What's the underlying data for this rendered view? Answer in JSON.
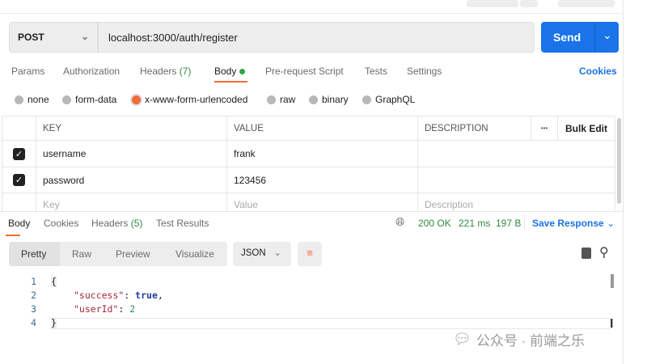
{
  "request": {
    "method": "POST",
    "url": "localhost:3000/auth/register",
    "send_label": "Send"
  },
  "tabs": [
    {
      "label": "Params"
    },
    {
      "label": "Authorization"
    },
    {
      "label": "Headers",
      "count": "(7)"
    },
    {
      "label": "Body"
    },
    {
      "label": "Pre-request Script"
    },
    {
      "label": "Tests"
    },
    {
      "label": "Settings"
    }
  ],
  "cookies_label": "Cookies",
  "body_types": [
    "none",
    "form-data",
    "x-www-form-urlencoded",
    "raw",
    "binary",
    "GraphQL"
  ],
  "selected_body_type": "x-www-form-urlencoded",
  "table": {
    "headers": {
      "key": "KEY",
      "value": "VALUE",
      "description": "DESCRIPTION",
      "more": "•••",
      "bulk_edit": "Bulk Edit"
    },
    "rows": [
      {
        "key": "username",
        "value": "frank",
        "checked": true
      },
      {
        "key": "password",
        "value": "123456",
        "checked": true
      }
    ],
    "placeholders": {
      "key": "Key",
      "value": "Value",
      "description": "Description"
    }
  },
  "response": {
    "tabs": [
      {
        "label": "Body"
      },
      {
        "label": "Cookies"
      },
      {
        "label": "Headers",
        "count": "(5)"
      },
      {
        "label": "Test Results"
      }
    ],
    "status": "200 OK",
    "time": "221 ms",
    "size": "197 B",
    "save_label": "Save Response",
    "views": [
      "Pretty",
      "Raw",
      "Preview",
      "Visualize"
    ],
    "format": "JSON",
    "lines": [
      "1",
      "2",
      "3",
      "4"
    ],
    "json": {
      "open": "{",
      "k1": "\"success\"",
      "v1": "true",
      "k2": "\"userId\"",
      "v2": "2",
      "close": "}"
    }
  },
  "watermark": "公众号 · 前端之乐",
  "colors": {
    "accent": "#1a73e8",
    "active_tab": "#f26b3a",
    "status": "#2e8b3e"
  }
}
